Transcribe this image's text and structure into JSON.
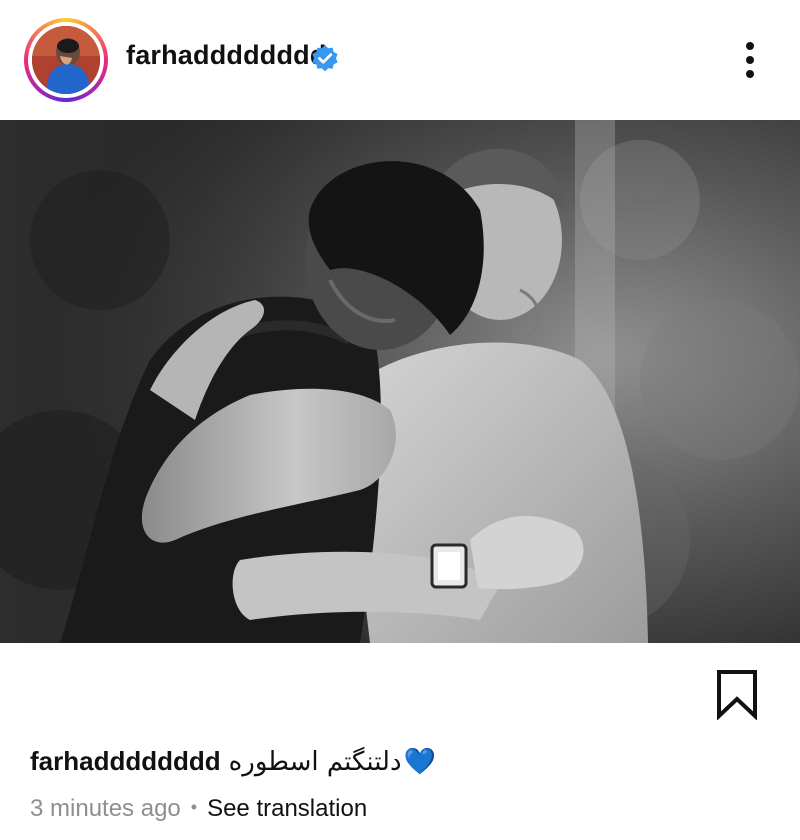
{
  "post": {
    "header": {
      "username": "farhadddddddd",
      "verified": true,
      "avatar_icon": "profile-avatar",
      "more_icon": "more-vertical-icon"
    },
    "image": {
      "description_icon": "photo-embrace"
    },
    "actions": {
      "bookmark_icon": "bookmark-icon"
    },
    "caption": {
      "username": "farhadddddddd",
      "text": "دلتنگتم اسطوره",
      "emoji": "💙"
    },
    "meta": {
      "time": "3 minutes ago",
      "separator": "•",
      "translate_label": "See translation"
    }
  },
  "colors": {
    "verified_blue": "#3897f0",
    "meta_gray": "#8e8e8e",
    "text": "#111111",
    "heart_blue": "#4aa8e8"
  }
}
